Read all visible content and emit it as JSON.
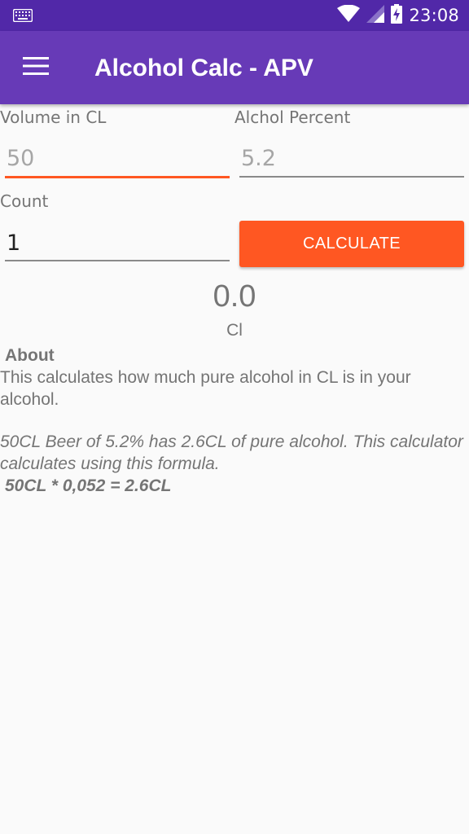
{
  "status_bar": {
    "time": "23:08",
    "left_icon": "keyboard-icon",
    "icons": [
      "wifi-icon",
      "cell-signal-icon",
      "battery-charging-icon"
    ]
  },
  "app_bar": {
    "menu_icon": "hamburger-menu-icon",
    "title": "Alcohol Calc - APV"
  },
  "form": {
    "volume_label": "Volume in CL",
    "volume_placeholder": "50",
    "percent_label": "Alchol Percent",
    "percent_placeholder": "5.2",
    "count_label": "Count",
    "count_value": "1",
    "calculate_label": "CALCULATE"
  },
  "result": {
    "value": "0.0",
    "unit": "Cl"
  },
  "about": {
    "heading": "About",
    "text": " This calculates how much pure alcohol in CL is in your alcohol.",
    "example": " 50CL Beer of 5.2% has 2.6CL of pure alcohol. This calculator calculates using this formula.",
    "formula": "50CL * 0,052 = 2.6CL"
  },
  "colors": {
    "status_bar": "#5128a8",
    "app_bar": "#673ab7",
    "accent": "#ff5722",
    "background": "#fafafa",
    "text_secondary": "#757575"
  }
}
